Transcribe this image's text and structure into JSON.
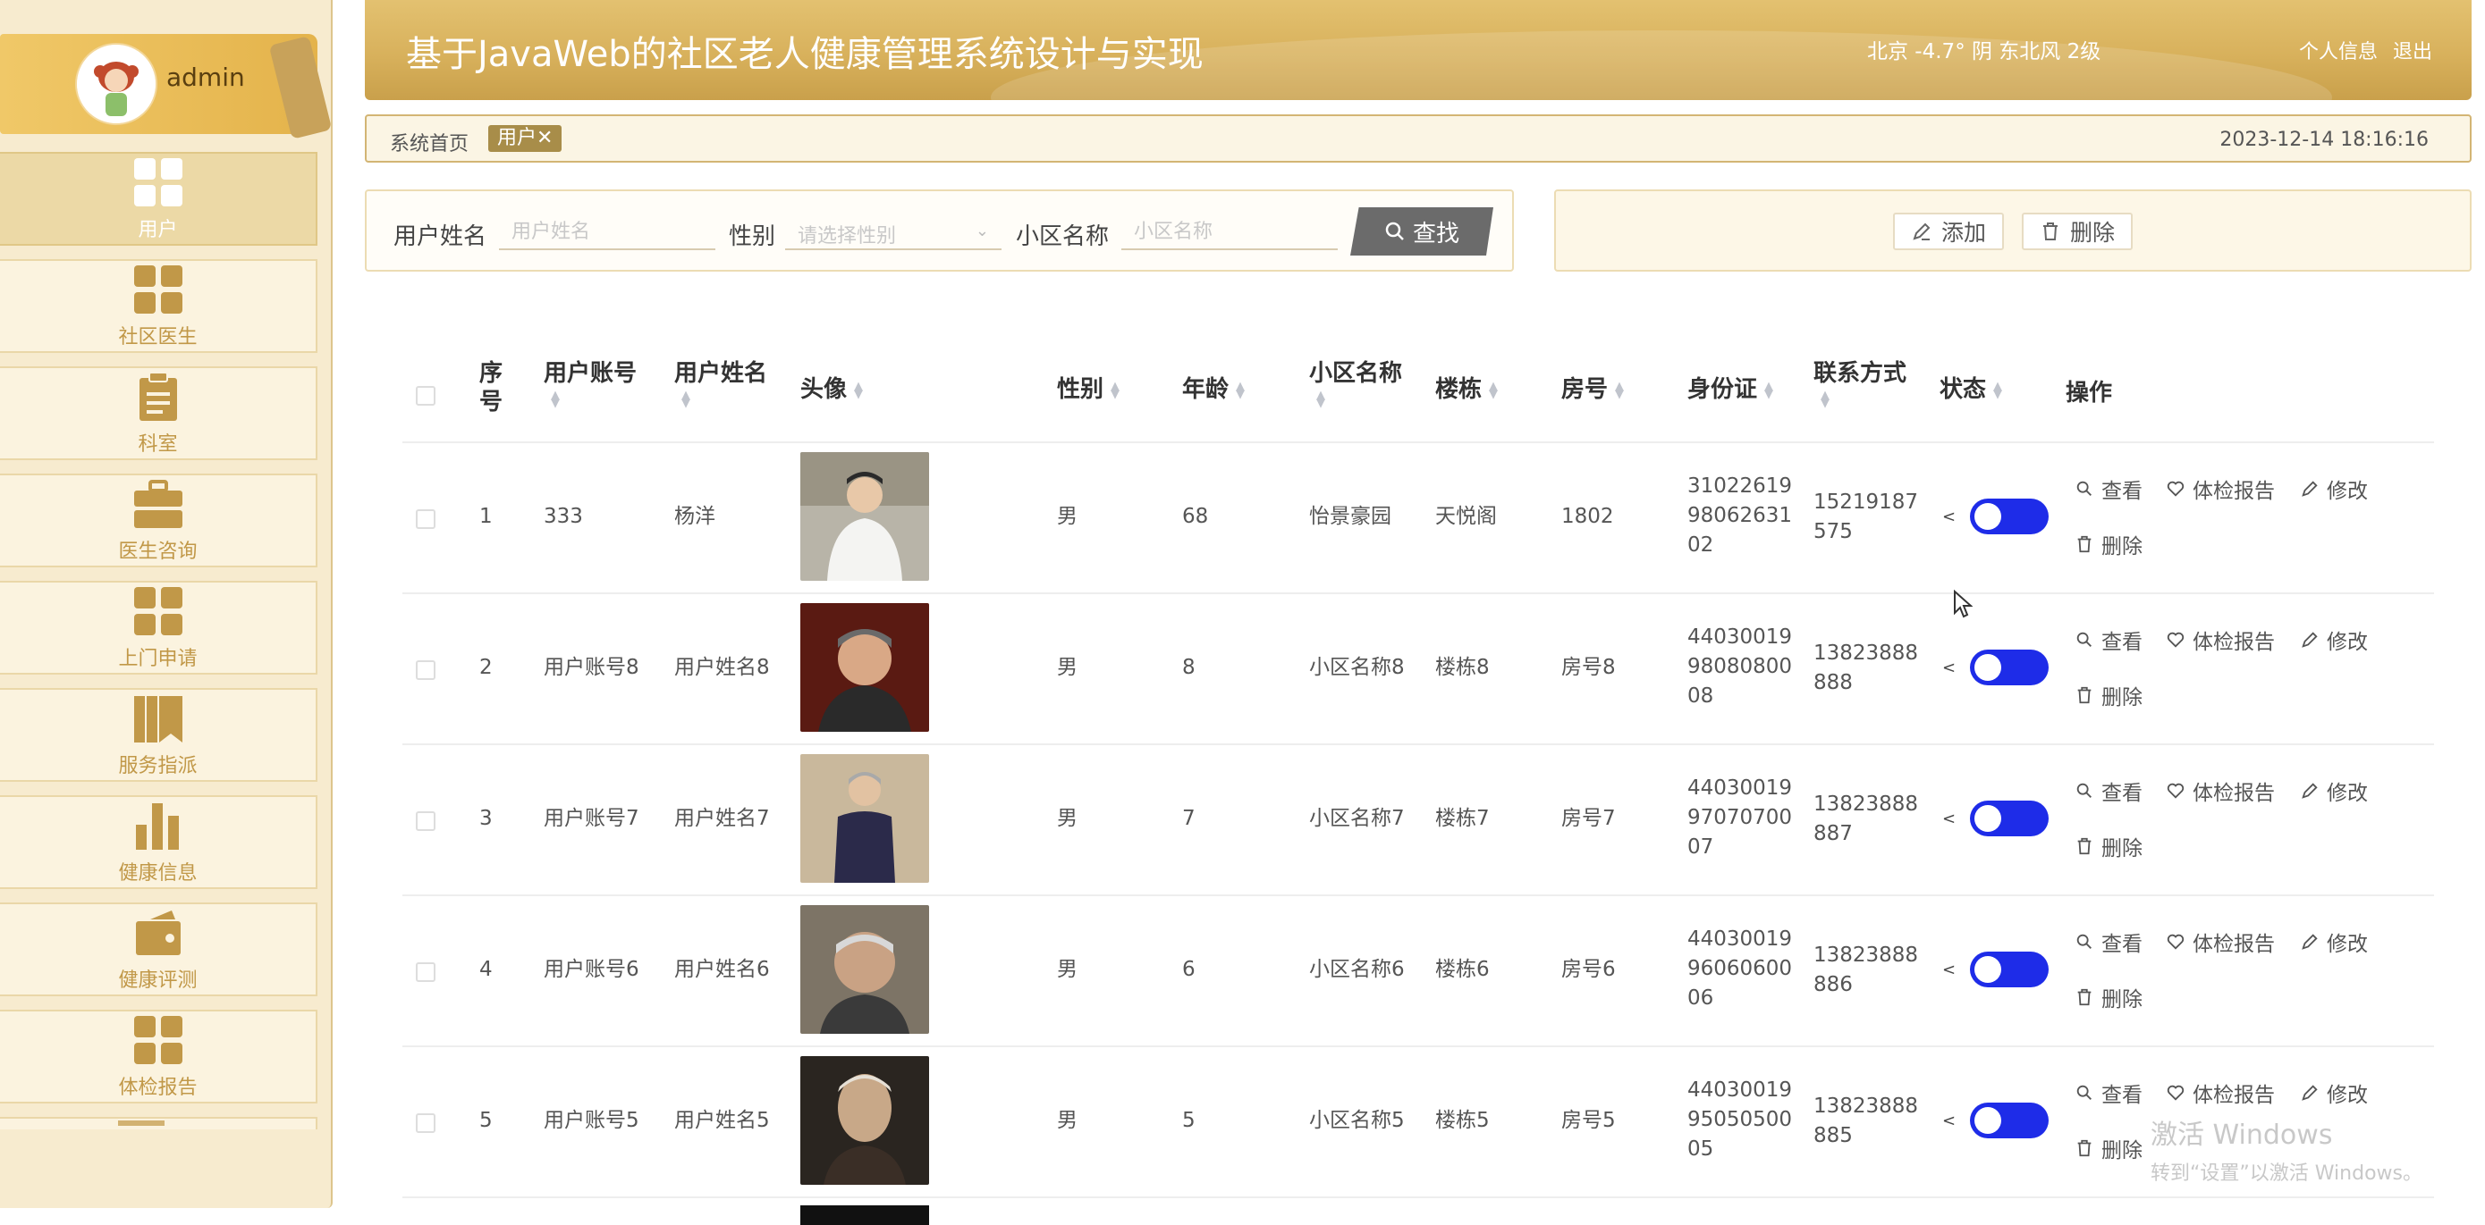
{
  "app": {
    "title": "基于JavaWeb的社区老人健康管理系统设计与实现",
    "weather": "北京  -4.7°  阴  东北风  2级",
    "links": [
      "个人信息",
      "退出"
    ]
  },
  "user": {
    "name": "admin"
  },
  "sidebar": {
    "items": [
      {
        "label": "用户",
        "icon": "grid-icon",
        "active": true
      },
      {
        "label": "社区医生",
        "icon": "grid-icon"
      },
      {
        "label": "科室",
        "icon": "clipboard-icon"
      },
      {
        "label": "医生咨询",
        "icon": "briefcase-icon"
      },
      {
        "label": "上门申请",
        "icon": "grid-icon"
      },
      {
        "label": "服务指派",
        "icon": "book-icon"
      },
      {
        "label": "健康信息",
        "icon": "bar-chart-icon"
      },
      {
        "label": "健康评测",
        "icon": "wallet-icon"
      },
      {
        "label": "体检报告",
        "icon": "grid-icon"
      }
    ]
  },
  "breadcrumb": {
    "home": "系统首页",
    "tab": "用户",
    "close": "✕",
    "datetime": "2023-12-14 18:16:16"
  },
  "search": {
    "username_label": "用户姓名",
    "username_placeholder": "用户姓名",
    "gender_label": "性别",
    "gender_placeholder": "请选择性别",
    "community_label": "小区名称",
    "community_placeholder": "小区名称",
    "search_button": "查找"
  },
  "actions": {
    "add": "添加",
    "delete": "删除"
  },
  "table": {
    "columns": [
      "序号",
      "用户账号",
      "用户姓名",
      "头像",
      "性别",
      "年龄",
      "小区名称",
      "楼栋",
      "房号",
      "身份证",
      "联系方式",
      "状态",
      "操作"
    ],
    "rows": [
      {
        "index": "1",
        "account": "333",
        "name": "杨洋",
        "gender": "男",
        "age": "68",
        "community": "怡景豪园",
        "building": "天悦阁",
        "room": "1802",
        "id_lines": [
          "31022619",
          "98062631",
          "02"
        ],
        "phone_lines": [
          "15219187",
          "575"
        ],
        "status_on": true
      },
      {
        "index": "2",
        "account": "用户账号8",
        "name": "用户姓名8",
        "gender": "男",
        "age": "8",
        "community": "小区名称8",
        "building": "楼栋8",
        "room": "房号8",
        "id_lines": [
          "44030019",
          "98080800",
          "08"
        ],
        "phone_lines": [
          "13823888",
          "888"
        ],
        "status_on": true
      },
      {
        "index": "3",
        "account": "用户账号7",
        "name": "用户姓名7",
        "gender": "男",
        "age": "7",
        "community": "小区名称7",
        "building": "楼栋7",
        "room": "房号7",
        "id_lines": [
          "44030019",
          "97070700",
          "07"
        ],
        "phone_lines": [
          "13823888",
          "887"
        ],
        "status_on": true
      },
      {
        "index": "4",
        "account": "用户账号6",
        "name": "用户姓名6",
        "gender": "男",
        "age": "6",
        "community": "小区名称6",
        "building": "楼栋6",
        "room": "房号6",
        "id_lines": [
          "44030019",
          "96060600",
          "06"
        ],
        "phone_lines": [
          "13823888",
          "886"
        ],
        "status_on": true
      },
      {
        "index": "5",
        "account": "用户账号5",
        "name": "用户姓名5",
        "gender": "男",
        "age": "5",
        "community": "小区名称5",
        "building": "楼栋5",
        "room": "房号5",
        "id_lines": [
          "44030019",
          "95050500",
          "05"
        ],
        "phone_lines": [
          "13823888",
          "885"
        ],
        "status_on": true
      }
    ],
    "row_ops": [
      "查看",
      "体检报告",
      "修改",
      "删除"
    ]
  },
  "watermark": {
    "line1": "激活 Windows",
    "line2": "转到“设置”以激活 Windows。"
  },
  "colors": {
    "accent": "#d8b15c",
    "sidebar_bg": "#f7ebcf",
    "toggle_on": "#1e2ce8",
    "search_btn": "#6b6b6b"
  }
}
